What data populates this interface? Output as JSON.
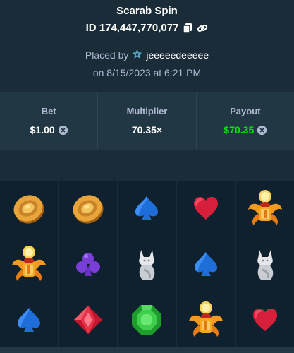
{
  "header": {
    "game_title": "Scarab Spin",
    "bet_id": "ID 174,447,770,077",
    "placed_by_label": "Placed by",
    "username": "jeeeeedeeeee",
    "placed_on": "on 8/15/2023 at 6:21 PM"
  },
  "stats": {
    "bet_label": "Bet",
    "bet_value": "$1.00",
    "multiplier_label": "Multiplier",
    "multiplier_value": "70.35×",
    "payout_label": "Payout",
    "payout_value": "$70.35"
  },
  "colors": {
    "background": "#1a2c38",
    "panel": "#213743",
    "reel_bg": "#0f212e",
    "payout_green": "#00e701",
    "muted_text": "#b1bad3"
  },
  "reels": [
    [
      "coin",
      "scarab",
      "spade"
    ],
    [
      "coin",
      "club",
      "diamond"
    ],
    [
      "spade",
      "cat",
      "emerald"
    ],
    [
      "heart",
      "spade",
      "scarab"
    ],
    [
      "scarab",
      "cat",
      "heart"
    ]
  ]
}
